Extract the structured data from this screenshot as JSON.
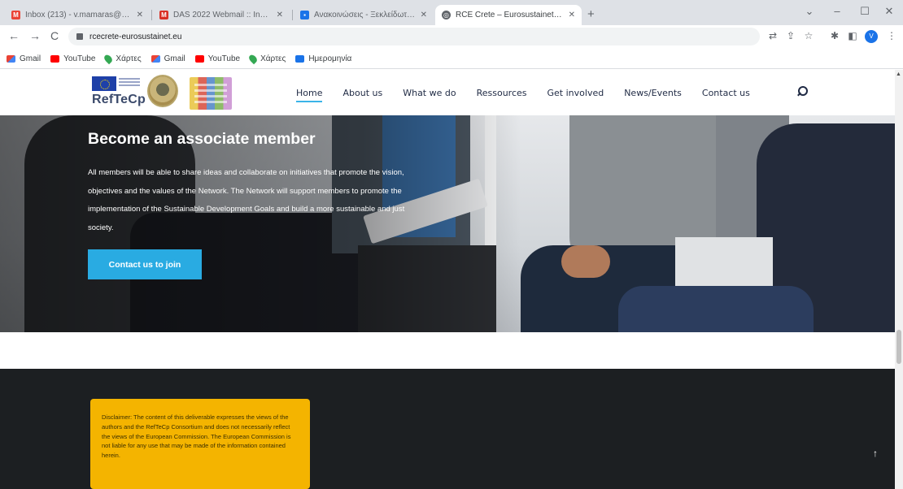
{
  "browser": {
    "tabs": [
      {
        "label": "Inbox (213) - v.mamaras@gmai...",
        "favicon": "gmail-icon",
        "active": false
      },
      {
        "label": "DAS 2022 Webmail :: Inbox",
        "favicon": "webmail-icon",
        "active": false
      },
      {
        "label": "Ανακοινώσεις - Ξεκλείδωτο Μ...",
        "favicon": "document-icon",
        "active": false
      },
      {
        "label": "RCE Crete – Eurosustainet – Sust...",
        "favicon": "globe-icon",
        "active": true
      }
    ],
    "new_tab_label": "+",
    "window_controls": {
      "chevron": "⌄",
      "minimize": "–",
      "maximize": "☐",
      "close": "✕"
    },
    "address": "rcecrete-eurosustainet.eu",
    "nav": {
      "back": "←",
      "forward": "→",
      "reload": "C"
    },
    "toolbar_icons": [
      "translate-icon",
      "share-icon",
      "star-icon",
      "extensions-icon",
      "sidepanel-icon"
    ],
    "profile_initial": "V",
    "menu_icon": "⋮",
    "bookmarks": [
      {
        "label": "Gmail",
        "icon": "gmail"
      },
      {
        "label": "YouTube",
        "icon": "yt"
      },
      {
        "label": "Χάρτες",
        "icon": "maps"
      },
      {
        "label": "Gmail",
        "icon": "gmail"
      },
      {
        "label": "YouTube",
        "icon": "yt"
      },
      {
        "label": "Χάρτες",
        "icon": "maps"
      },
      {
        "label": "Ημερομηνία",
        "icon": "blue"
      }
    ]
  },
  "site": {
    "logo_text": "RefTeCp",
    "nav": [
      "Home",
      "About us",
      "What we do",
      "Ressources",
      "Get involved",
      "News/Events",
      "Contact us"
    ],
    "active_nav": "Home"
  },
  "hero": {
    "title": "Become an associate member",
    "text": "All members will be able to share ideas and collaborate on initiatives that promote the vision, objectives and the values of the Network. The Network will support members to promote the implementation of the Sustainable Development Goals and build a more sustainable and just society.",
    "cta": "Contact us to join"
  },
  "footer": {
    "disclaimer": "Disclaimer: The content of this deliverable expresses the views of the authors and the RefTeCp Consortium and does not necessarily reflect the views of the European Commission. The European Commission is not liable for any use that may be made of the information contained herein.",
    "back_to_top": "↑"
  },
  "colors": {
    "accent": "#29abe2",
    "footer_bg": "#1c1f22",
    "disclaimer_bg": "#f4b400",
    "nav_text": "#1f2a44"
  }
}
